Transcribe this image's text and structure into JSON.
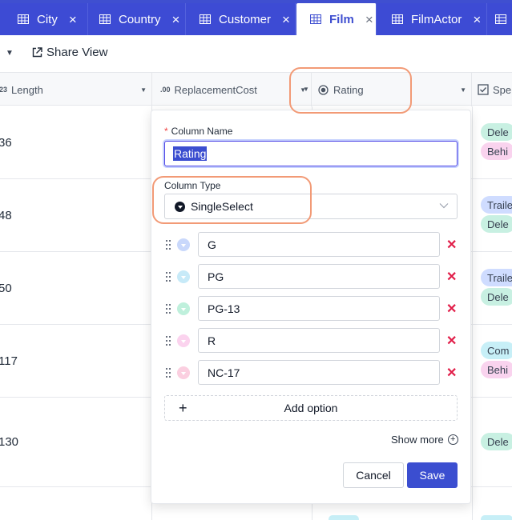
{
  "tabs": [
    {
      "label": "City",
      "active": false
    },
    {
      "label": "Country",
      "active": false
    },
    {
      "label": "Customer",
      "active": false
    },
    {
      "label": "Film",
      "active": true
    },
    {
      "label": "FilmActor",
      "active": false
    }
  ],
  "toolbar": {
    "share_view_label": "Share View"
  },
  "grid": {
    "columns": [
      {
        "label": "Length",
        "icon_text": "123"
      },
      {
        "label": "ReplacementCost",
        "icon_text": ".00"
      },
      {
        "label": "Rating",
        "icon": "radio-icon"
      },
      {
        "label": "Spe",
        "icon": "checklist-icon"
      }
    ],
    "rows": [
      {
        "length": "36",
        "tags": [
          {
            "text": "Dele",
            "color": "green"
          },
          {
            "text": "Behi",
            "color": "pink"
          }
        ]
      },
      {
        "length": "48",
        "tags": [
          {
            "text": "Traile",
            "color": "blue"
          },
          {
            "text": "Dele",
            "color": "green"
          }
        ]
      },
      {
        "length": "50",
        "tags": [
          {
            "text": "Traile",
            "color": "blue"
          },
          {
            "text": "Dele",
            "color": "green"
          }
        ]
      },
      {
        "length": "117",
        "tags": [
          {
            "text": "Com",
            "color": "cyan"
          },
          {
            "text": "Behi",
            "color": "pink"
          }
        ]
      },
      {
        "length": "130",
        "tags": [
          {
            "text": "Dele",
            "color": "green"
          }
        ]
      }
    ]
  },
  "column_editor": {
    "column_name_label": "Column Name",
    "column_name_required_mark": "*",
    "column_name_value": "Rating",
    "column_type_label": "Column Type",
    "column_type_value": "SingleSelect",
    "options": [
      {
        "value": "G",
        "color": "#c9d8fb"
      },
      {
        "value": "PG",
        "color": "#c7eaf8"
      },
      {
        "value": "PG-13",
        "color": "#bff0dc"
      },
      {
        "value": "R",
        "color": "#fbd3ee"
      },
      {
        "value": "NC-17",
        "color": "#fbcfe0"
      }
    ],
    "add_option_label": "Add option",
    "show_more_label": "Show more",
    "cancel_label": "Cancel",
    "save_label": "Save"
  },
  "colors": {
    "accent": "#3b4ed0",
    "highlight": "#f29a76",
    "delete": "#e11d48"
  }
}
